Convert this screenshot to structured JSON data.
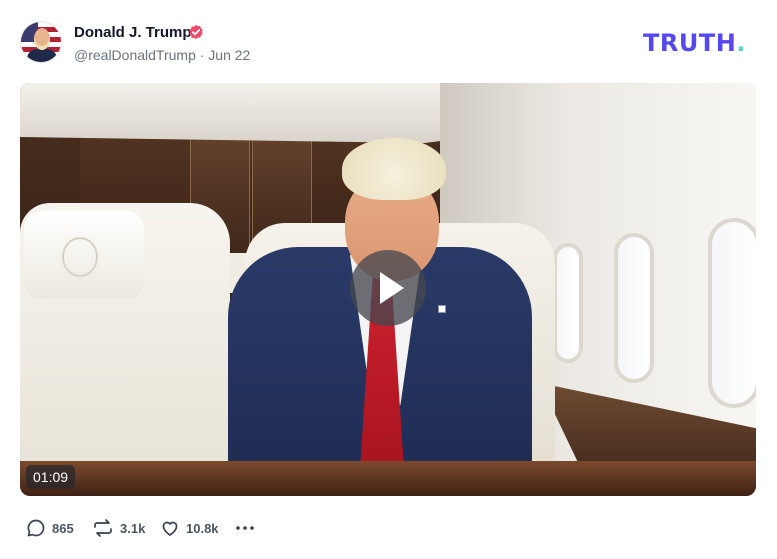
{
  "author": {
    "display_name": "Donald J. Trump",
    "meta": "@realDonaldTrump · Jun 22",
    "verified_badge_color": "#ef4a6a"
  },
  "brand": {
    "wordmark": "TRUTH",
    "wordmark_dot": ".",
    "wordmark_color": "#5448ee",
    "dot_color": "#5dd6c9"
  },
  "media": {
    "type": "video",
    "duration": "01:09"
  },
  "actions": {
    "replies": "865",
    "retruths": "3.1k",
    "likes": "10.8k"
  },
  "icons": [
    "verified-badge-icon",
    "play-icon",
    "reply-icon",
    "retruth-icon",
    "like-icon",
    "more-icon"
  ]
}
